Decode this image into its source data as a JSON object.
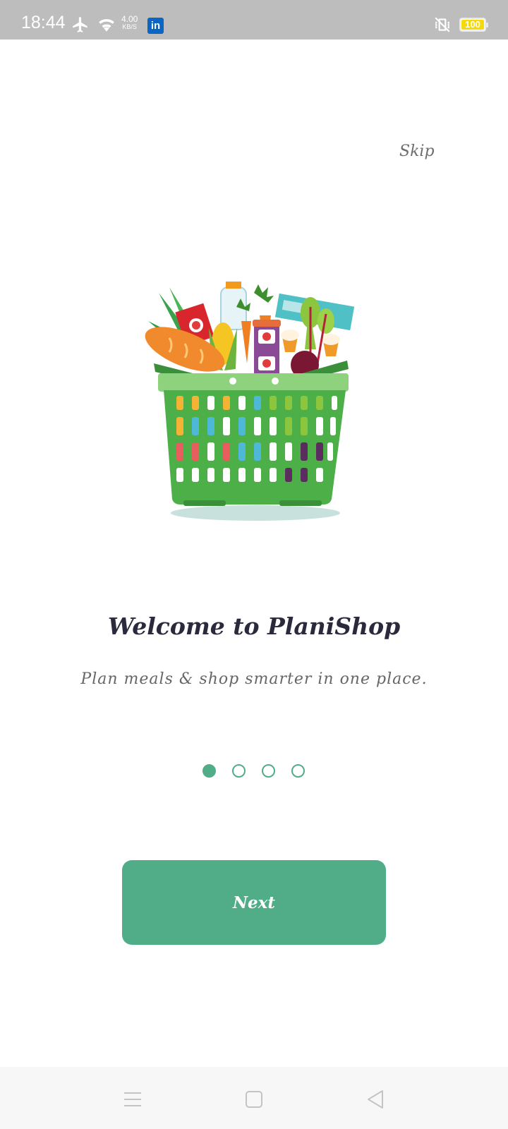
{
  "status_bar": {
    "time": "18:44",
    "net_speed_value": "4.00",
    "net_speed_unit": "KB/S",
    "linkedin_badge": "in",
    "battery_level": "100",
    "icons": [
      "airplane-icon",
      "wifi-icon",
      "linkedin-icon",
      "vibrate-icon",
      "battery-icon"
    ]
  },
  "onboarding": {
    "skip_label": "Skip",
    "title": "Welcome to PlaniShop",
    "subtitle": "Plan meals & shop smarter in one place.",
    "page_count": 4,
    "current_page": 1,
    "next_label": "Next"
  },
  "nav_bar": {
    "icons": [
      "menu-icon",
      "home-icon",
      "back-icon"
    ]
  },
  "colors": {
    "accent": "#50ad87",
    "title": "#2b2a3c",
    "subtitle": "#666666",
    "status_bar": "#bdbdbd"
  }
}
